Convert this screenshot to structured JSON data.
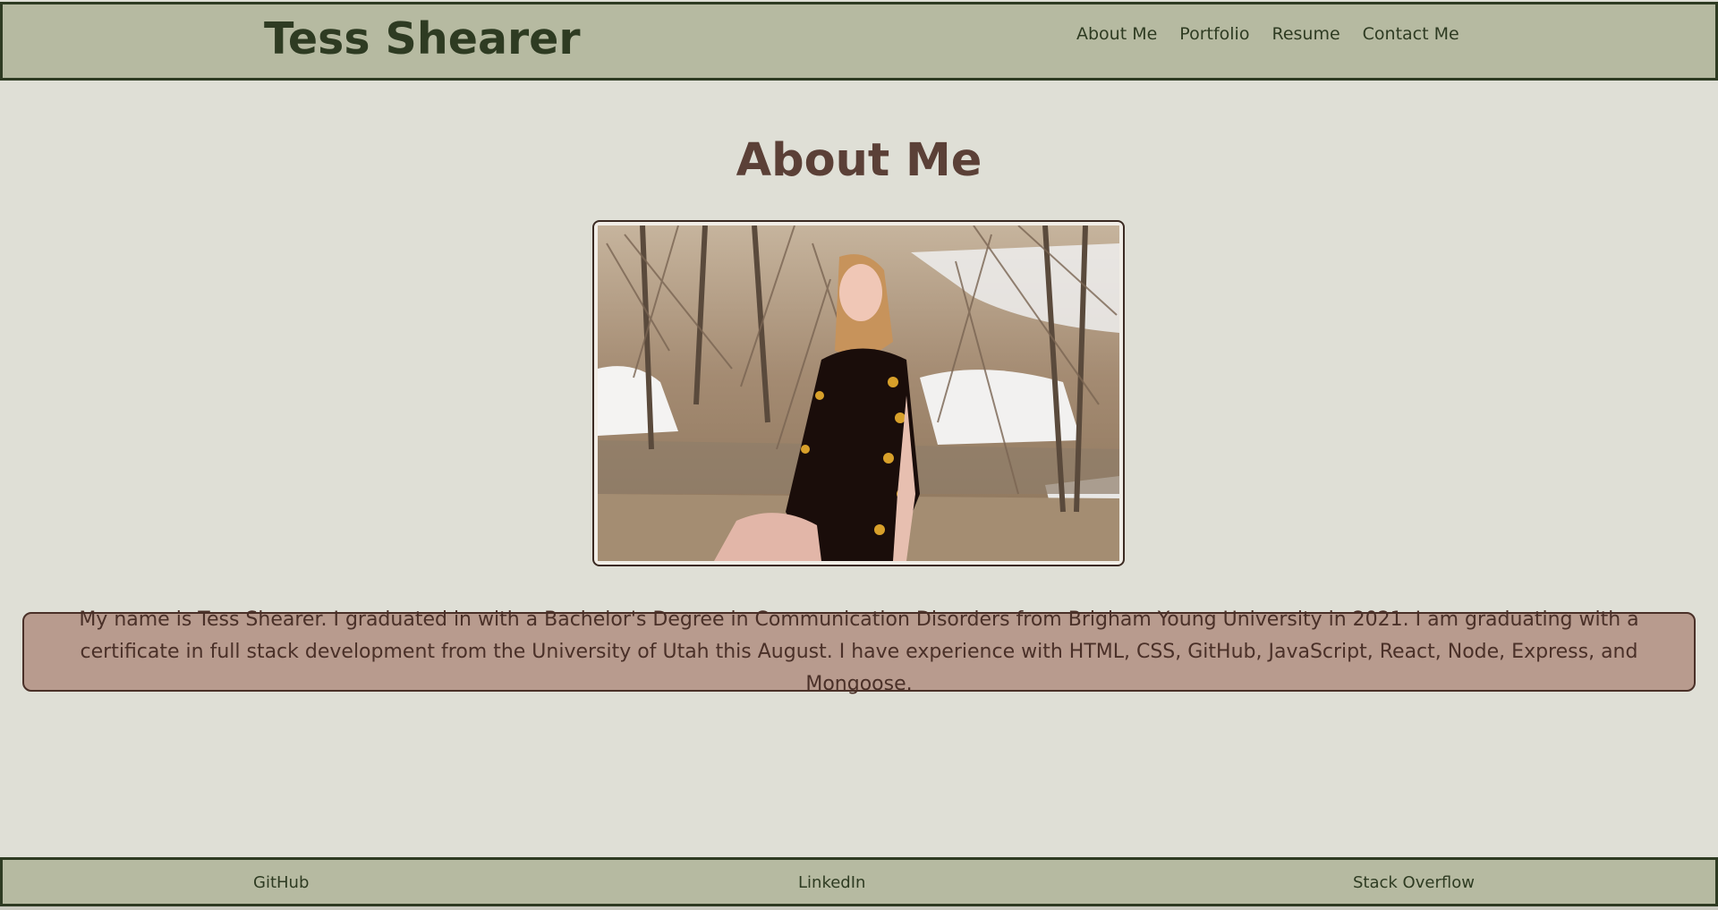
{
  "header": {
    "title": "Tess Shearer",
    "nav": [
      {
        "label": "About Me"
      },
      {
        "label": "Portfolio"
      },
      {
        "label": "Resume"
      },
      {
        "label": "Contact Me"
      }
    ]
  },
  "main": {
    "heading": "About Me",
    "bio": "My name is Tess Shearer. I graduated in with a Bachelor's Degree in Communication Disorders from Brigham Young University in 2021. I am graduating with a certificate in full stack development from the University of Utah this August. I have experience with HTML, CSS, GitHub, JavaScript, React, Node, Express, and Mongoose."
  },
  "footer": {
    "links": [
      {
        "label": "GitHub"
      },
      {
        "label": "LinkedIn"
      },
      {
        "label": "Stack Overflow"
      }
    ]
  },
  "colors": {
    "page_bg": "#dfdfd6",
    "bar_bg": "#b6baa1",
    "bar_border": "#2e3b22",
    "heading": "#5b4037",
    "bio_bg": "#b89b8e"
  }
}
